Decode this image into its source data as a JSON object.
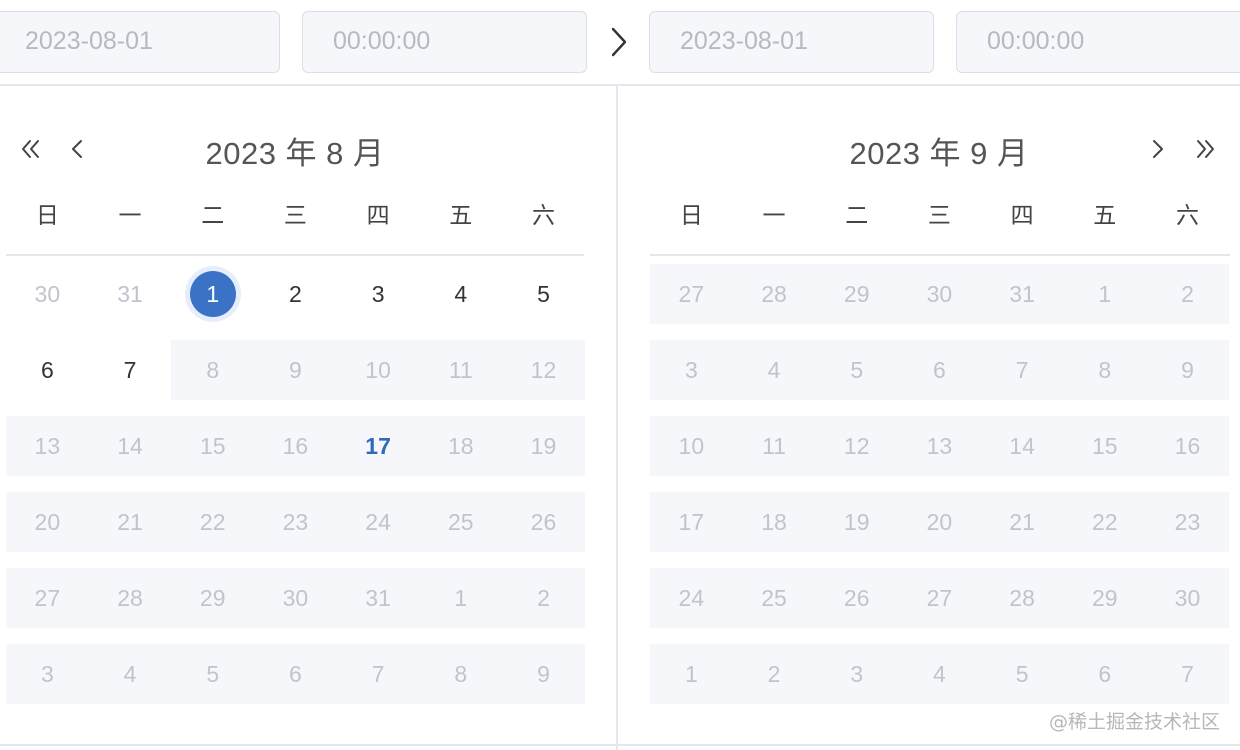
{
  "inputs": {
    "start_date": "2023-08-01",
    "start_time": "00:00:00",
    "end_date": "2023-08-01",
    "end_time": "00:00:00"
  },
  "colors": {
    "accent": "#3a73c6",
    "today": "#2f6bb8",
    "disabled_text": "#c0c4cc",
    "disabled_bg": "#f5f7fa"
  },
  "left": {
    "title": "2023 年 8 月",
    "weekdays": [
      "日",
      "一",
      "二",
      "三",
      "四",
      "五",
      "六"
    ],
    "rows": [
      [
        {
          "d": "30",
          "s": "dis"
        },
        {
          "d": "31",
          "s": "dis"
        },
        {
          "d": "1",
          "s": "sel"
        },
        {
          "d": "2",
          "s": ""
        },
        {
          "d": "3",
          "s": ""
        },
        {
          "d": "4",
          "s": ""
        },
        {
          "d": "5",
          "s": ""
        }
      ],
      [
        {
          "d": "6",
          "s": ""
        },
        {
          "d": "7",
          "s": ""
        },
        {
          "d": "8",
          "s": "dis"
        },
        {
          "d": "9",
          "s": "dis"
        },
        {
          "d": "10",
          "s": "dis"
        },
        {
          "d": "11",
          "s": "dis"
        },
        {
          "d": "12",
          "s": "dis"
        }
      ],
      [
        {
          "d": "13",
          "s": "dis"
        },
        {
          "d": "14",
          "s": "dis"
        },
        {
          "d": "15",
          "s": "dis"
        },
        {
          "d": "16",
          "s": "dis"
        },
        {
          "d": "17",
          "s": "today"
        },
        {
          "d": "18",
          "s": "dis"
        },
        {
          "d": "19",
          "s": "dis"
        }
      ],
      [
        {
          "d": "20",
          "s": "dis"
        },
        {
          "d": "21",
          "s": "dis"
        },
        {
          "d": "22",
          "s": "dis"
        },
        {
          "d": "23",
          "s": "dis"
        },
        {
          "d": "24",
          "s": "dis"
        },
        {
          "d": "25",
          "s": "dis"
        },
        {
          "d": "26",
          "s": "dis"
        }
      ],
      [
        {
          "d": "27",
          "s": "dis"
        },
        {
          "d": "28",
          "s": "dis"
        },
        {
          "d": "29",
          "s": "dis"
        },
        {
          "d": "30",
          "s": "dis"
        },
        {
          "d": "31",
          "s": "dis"
        },
        {
          "d": "1",
          "s": "dis"
        },
        {
          "d": "2",
          "s": "dis"
        }
      ],
      [
        {
          "d": "3",
          "s": "dis"
        },
        {
          "d": "4",
          "s": "dis"
        },
        {
          "d": "5",
          "s": "dis"
        },
        {
          "d": "6",
          "s": "dis"
        },
        {
          "d": "7",
          "s": "dis"
        },
        {
          "d": "8",
          "s": "dis"
        },
        {
          "d": "9",
          "s": "dis"
        }
      ]
    ]
  },
  "right": {
    "title": "2023 年 9 月",
    "weekdays": [
      "日",
      "一",
      "二",
      "三",
      "四",
      "五",
      "六"
    ],
    "rows": [
      [
        {
          "d": "27",
          "s": "dis"
        },
        {
          "d": "28",
          "s": "dis"
        },
        {
          "d": "29",
          "s": "dis"
        },
        {
          "d": "30",
          "s": "dis"
        },
        {
          "d": "31",
          "s": "dis"
        },
        {
          "d": "1",
          "s": "dis"
        },
        {
          "d": "2",
          "s": "dis"
        }
      ],
      [
        {
          "d": "3",
          "s": "dis"
        },
        {
          "d": "4",
          "s": "dis"
        },
        {
          "d": "5",
          "s": "dis"
        },
        {
          "d": "6",
          "s": "dis"
        },
        {
          "d": "7",
          "s": "dis"
        },
        {
          "d": "8",
          "s": "dis"
        },
        {
          "d": "9",
          "s": "dis"
        }
      ],
      [
        {
          "d": "10",
          "s": "dis"
        },
        {
          "d": "11",
          "s": "dis"
        },
        {
          "d": "12",
          "s": "dis"
        },
        {
          "d": "13",
          "s": "dis"
        },
        {
          "d": "14",
          "s": "dis"
        },
        {
          "d": "15",
          "s": "dis"
        },
        {
          "d": "16",
          "s": "dis"
        }
      ],
      [
        {
          "d": "17",
          "s": "dis"
        },
        {
          "d": "18",
          "s": "dis"
        },
        {
          "d": "19",
          "s": "dis"
        },
        {
          "d": "20",
          "s": "dis"
        },
        {
          "d": "21",
          "s": "dis"
        },
        {
          "d": "22",
          "s": "dis"
        },
        {
          "d": "23",
          "s": "dis"
        }
      ],
      [
        {
          "d": "24",
          "s": "dis"
        },
        {
          "d": "25",
          "s": "dis"
        },
        {
          "d": "26",
          "s": "dis"
        },
        {
          "d": "27",
          "s": "dis"
        },
        {
          "d": "28",
          "s": "dis"
        },
        {
          "d": "29",
          "s": "dis"
        },
        {
          "d": "30",
          "s": "dis"
        }
      ],
      [
        {
          "d": "1",
          "s": "dis"
        },
        {
          "d": "2",
          "s": "dis"
        },
        {
          "d": "3",
          "s": "dis"
        },
        {
          "d": "4",
          "s": "dis"
        },
        {
          "d": "5",
          "s": "dis"
        },
        {
          "d": "6",
          "s": "dis"
        },
        {
          "d": "7",
          "s": "dis"
        }
      ]
    ]
  },
  "icons": {
    "prev_year": "double-chevron-left-icon",
    "prev_month": "chevron-left-icon",
    "next_month": "chevron-right-icon",
    "next_year": "double-chevron-right-icon",
    "range_separator": "chevron-right-icon"
  },
  "watermark": "@稀土掘金技术社区"
}
